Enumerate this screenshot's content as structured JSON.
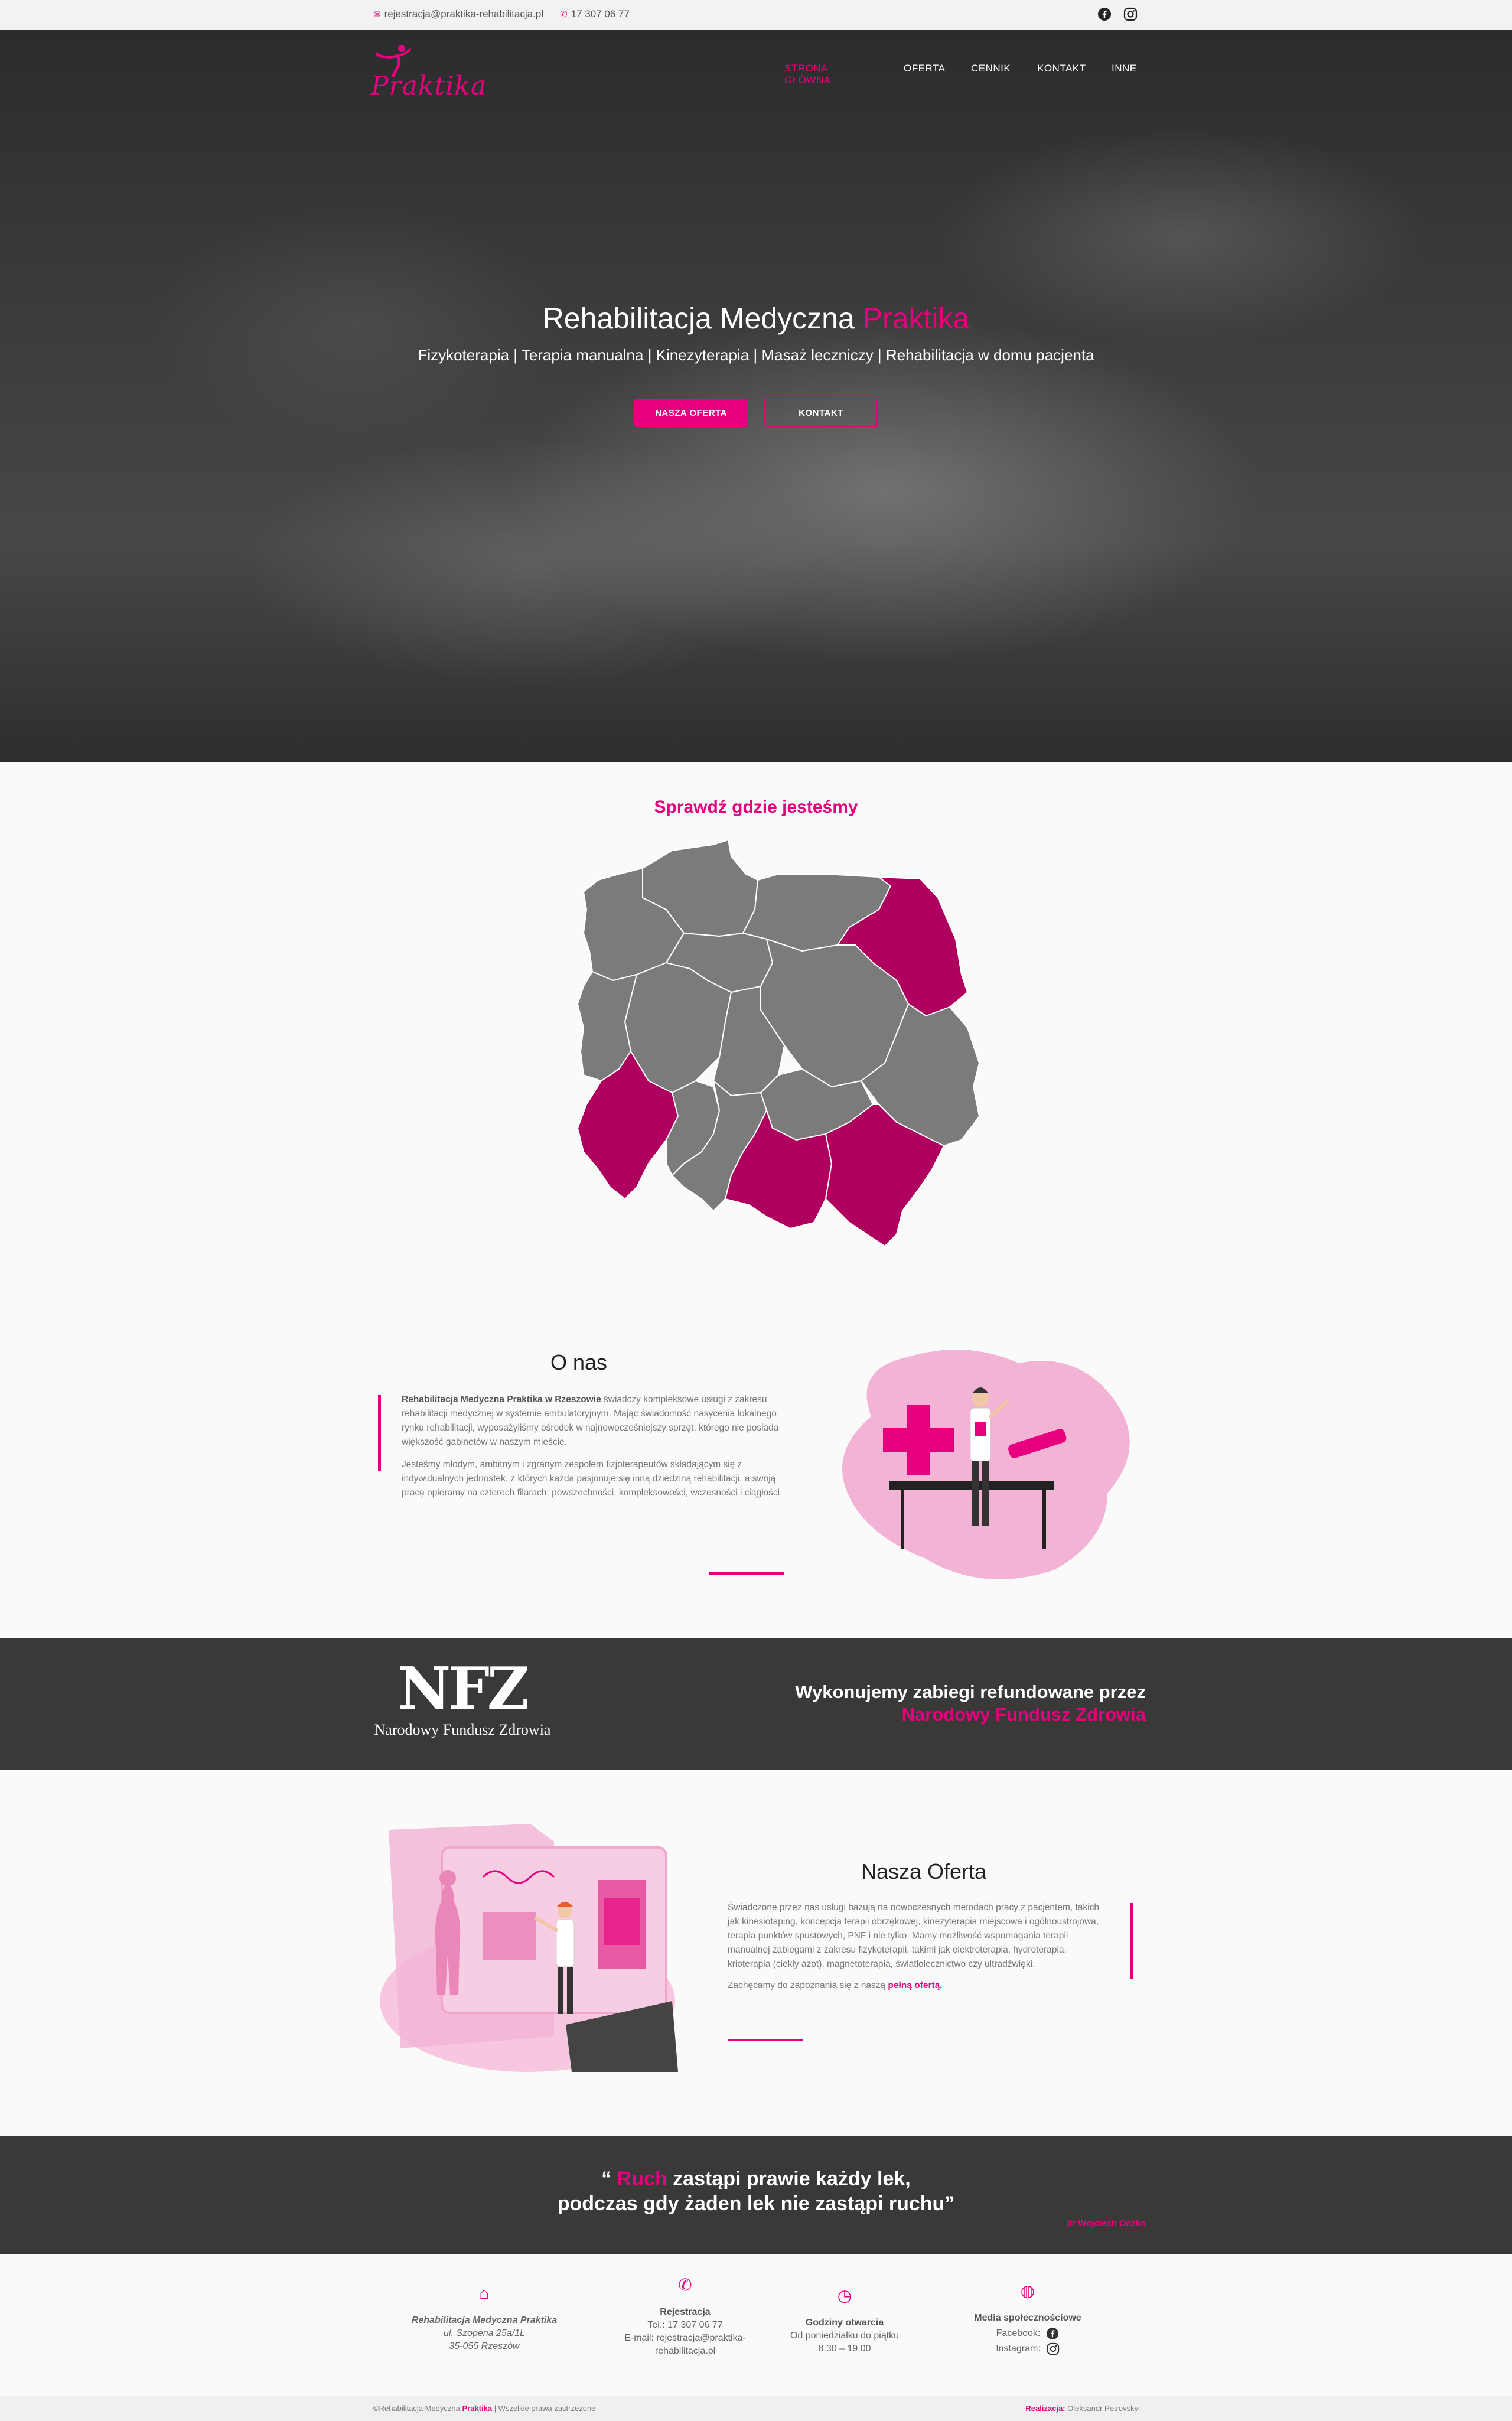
{
  "topbar": {
    "email": "rejestracja@praktika-rehabilitacja.pl",
    "phone": "17 307 06 77"
  },
  "brand": {
    "logo_text": "Praktika"
  },
  "nav": {
    "items": [
      "STRONA GŁÓWNA",
      "OFERTA",
      "CENNIK",
      "KONTAKT",
      "INNE"
    ]
  },
  "hero": {
    "title_main": "Rehabilitacja Medyczna ",
    "title_accent": "Praktika",
    "subtitle": "Fizykoterapia | Terapia manualna | Kinezyterapia | Masaż leczniczy | Rehabilitacja w domu pacjenta",
    "btn_offer": "NASZA OFERTA",
    "btn_contact": "KONTAKT"
  },
  "map": {
    "title": "Sprawdź gdzie jesteśmy"
  },
  "about": {
    "heading": "O nas",
    "p1_b1": "Rehabilitacja Medyczna ",
    "p1_accent": "Praktika",
    "p1_b2": " w Rzeszowie",
    "p1_rest": " świadczy kompleksowe usługi z zakresu rehabilitacji medycznej w systemie ambulatoryjnym. Mając świadomość nasycenia lokalnego rynku rehabilitacji, wyposażyliśmy ośrodek w najnowocześniejszy sprzęt, którego nie posiada większość gabinetów w naszym mieście.",
    "p2": "Jesteśmy młodym, ambitnym i zgranym zespołem fizjoterapeutów składającym się z indywidualnych jednostek, z których każda pasjonuje się inną dziedziną rehabilitacji, a swoją pracę opieramy na czterech filarach: powszechności, kompleksowości, wczesności i ciągłości."
  },
  "nfz": {
    "logo_letters": "NFZ",
    "logo_caption": "Narodowy Fundusz Zdrowia",
    "line1": "Wykonujemy zabiegi refundowane przez",
    "line2": "Narodowy Fundusz Zdrowia"
  },
  "offer": {
    "heading": "Nasza Oferta",
    "p1": "Świadczone przez nas usługi bazują na nowoczesnych metodach pracy z pacjentem, takich jak kinesiotaping, koncepcja terapii obrzękowej, kinezyterapia miejscowa i ogólnoustrojowa, terapia punktów spustowych, PNF i nie tylko. Mamy możliwość wspomagania terapii manualnej zabiegami z zakresu fizykoterapii, takimi jak elektroterapia, hydroterapia, krioterapia (ciekły azot), magnetoterapia, światłolecznictwo czy ultradźwięki.",
    "p2_text": "Zachęcamy do zapoznania się z naszą ",
    "p2_link": "pełną ofertą."
  },
  "quote": {
    "open": "“ ",
    "accent": "Ruch",
    "line1_rest": " zastąpi prawie każdy lek,",
    "line2": "podczas gdy żaden lek nie zastąpi ruchu”",
    "author": "dr Wojciech Oczko"
  },
  "footer": {
    "col1": {
      "name_main": "Rehabilitacja Medyczna ",
      "name_accent": "Praktika",
      "street": "ul. Szopena 25a/1L",
      "city": "35-055 Rzeszów"
    },
    "col2": {
      "title": "Rejestracja",
      "tel": "Tel.: 17 307 06 77",
      "email1": "E-mail: rejestracja@praktika-",
      "email2": "rehabilitacja.pl"
    },
    "col3": {
      "title": "Godziny otwarcia",
      "days": "Od poniedziałku do piątku",
      "hours": "8.30 – 19.00"
    },
    "col4": {
      "title": "Media społecznościowe",
      "facebook": "Facebook:",
      "instagram": "Instagram:"
    }
  },
  "bottombar": {
    "left_pre": "©Rehabilitacja Medyczna ",
    "left_accent": "Praktika",
    "left_post": " | Wszelkie prawa zastrzeżone",
    "right_label": "Realizacja:",
    "right_name": " Oleksandr Petrovskyi"
  },
  "colors": {
    "accent": "#e6007e",
    "dark_band": "#3a3938",
    "map_gray": "#7b7b7b",
    "map_active": "#b0005f"
  }
}
